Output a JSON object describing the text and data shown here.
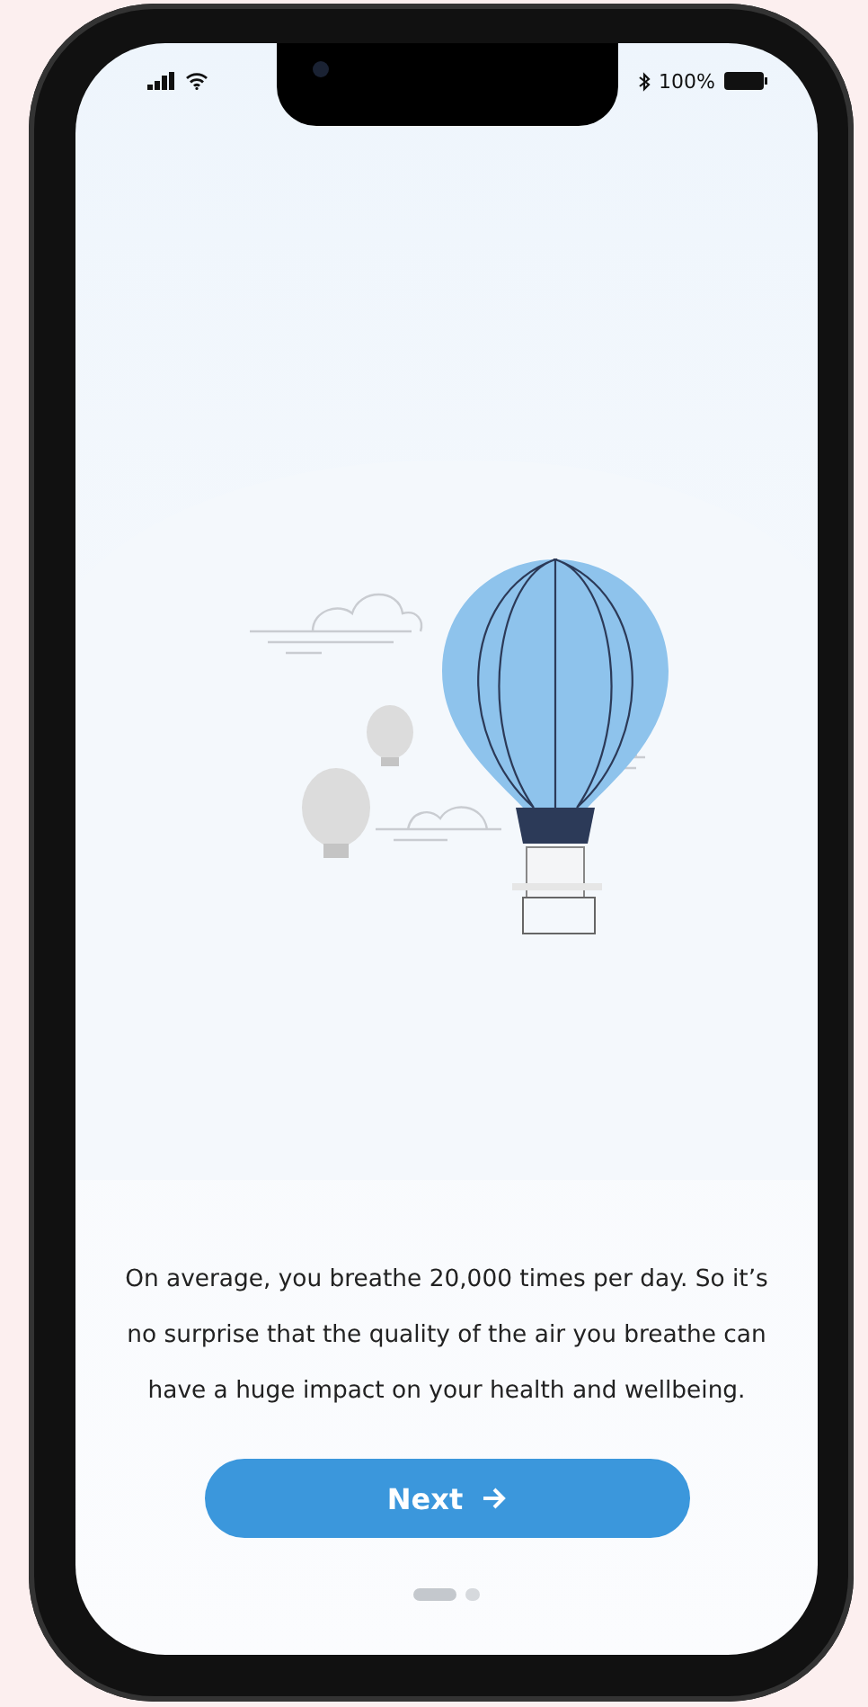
{
  "status_bar": {
    "battery": "100%"
  },
  "message": "On average, you breathe 20,000 times per day. So it’s no surprise that the quality of the air you breathe can have a huge impact on your health and wellbeing.",
  "next_button": {
    "label": "Next"
  },
  "pages": [
    {
      "selected": true
    },
    {
      "selected": false
    }
  ]
}
